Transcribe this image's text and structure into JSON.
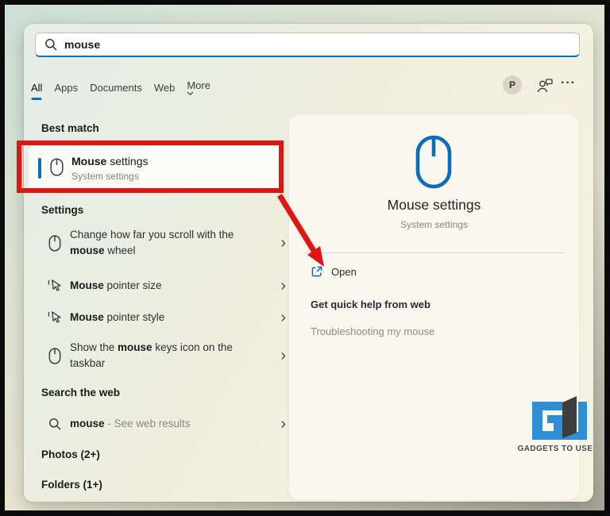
{
  "colors": {
    "accent": "#0a6ebd",
    "annotation": "#e11414",
    "logo_blue": "#2f8fd2",
    "logo_dark": "#3d3d3b"
  },
  "search": {
    "value": "mouse"
  },
  "tabs": {
    "active_index": 0,
    "items": [
      {
        "label": "All"
      },
      {
        "label": "Apps"
      },
      {
        "label": "Documents"
      },
      {
        "label": "Web"
      },
      {
        "label": "More"
      }
    ]
  },
  "topbar": {
    "avatar_initial": "P"
  },
  "left": {
    "best_match": {
      "heading": "Best match",
      "item": {
        "icon": "mouse-icon",
        "segments": [
          {
            "text": "Mouse",
            "bold": true
          },
          {
            "text": " settings"
          }
        ],
        "subtitle": "System settings"
      }
    },
    "settings": {
      "heading": "Settings",
      "items": [
        {
          "icon": "mouse-icon",
          "segments": [
            {
              "text": "Change how far you scroll with the "
            },
            {
              "text": "mouse",
              "bold": true
            },
            {
              "text": " wheel"
            }
          ]
        },
        {
          "icon": "pointer-icon",
          "segments": [
            {
              "text": "Mouse",
              "bold": true
            },
            {
              "text": " pointer size"
            }
          ]
        },
        {
          "icon": "pointer-icon",
          "segments": [
            {
              "text": "Mouse",
              "bold": true
            },
            {
              "text": " pointer style"
            }
          ]
        },
        {
          "icon": "mouse-icon",
          "segments": [
            {
              "text": "Show the "
            },
            {
              "text": "mouse",
              "bold": true
            },
            {
              "text": " keys icon on the taskbar"
            }
          ]
        }
      ]
    },
    "web": {
      "heading": "Search the web",
      "item": {
        "icon": "search-icon",
        "segments": [
          {
            "text": "mouse",
            "bold": true
          },
          {
            "text": " - See web results",
            "muted": true
          }
        ]
      }
    },
    "photos_heading": "Photos (2+)",
    "folders_heading": "Folders (1+)"
  },
  "panel": {
    "icon": "mouse-icon",
    "title": "Mouse settings",
    "subtitle": "System settings",
    "open_label": "Open",
    "quick_help": "Get quick help from web",
    "troubleshoot": "Troubleshooting my mouse"
  },
  "watermark": {
    "label": "GADGETS TO USE"
  }
}
